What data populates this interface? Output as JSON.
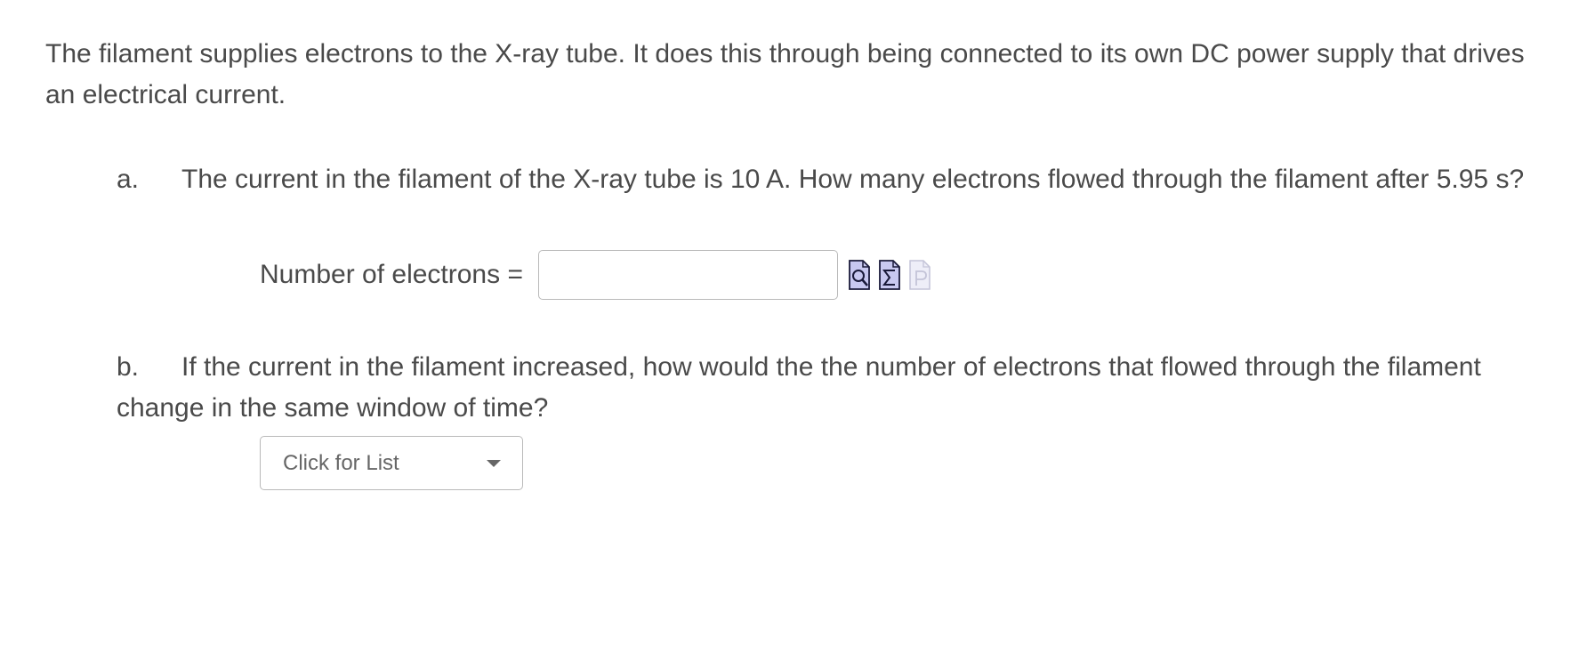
{
  "intro": {
    "text": "The filament supplies electrons to the X-ray tube. It does this through being connected to its own DC power supply that drives an electrical current."
  },
  "question_a": {
    "marker": "a.",
    "text": "The current in the filament of the X-ray tube is 10 A. How many electrons flowed through the filament after 5.95 s?",
    "answer_label": "Number of electrons =",
    "answer_value": "",
    "icons": [
      "preview-icon",
      "equation-icon",
      "help-icon"
    ]
  },
  "question_b": {
    "marker": "b.",
    "text": "If the current in the filament increased, how would the the number of electrons that flowed through the filament change in the same window of time?",
    "select_value": "Click for List"
  },
  "colors": {
    "text": "#4a4a4a",
    "border": "#b9b9b9",
    "icon_fill": "#c8c8f0",
    "icon_stroke": "#1a1a3a"
  }
}
